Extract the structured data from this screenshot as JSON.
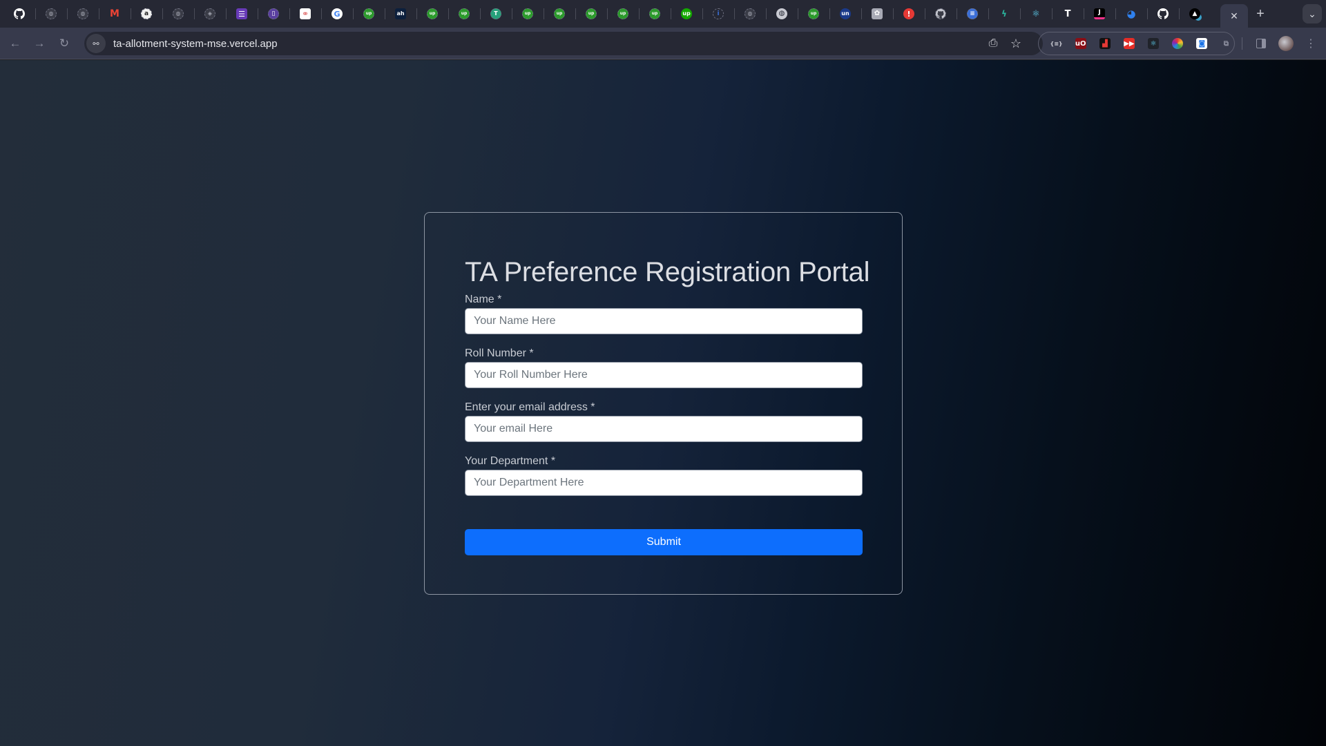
{
  "browser": {
    "tabs": [
      {
        "icon": "github-icon",
        "glyph": "",
        "style": "gh"
      },
      {
        "icon": "globe-icon",
        "glyph": "◍",
        "style": "globe"
      },
      {
        "icon": "globe-icon",
        "glyph": "◍",
        "style": "globe"
      },
      {
        "icon": "gmail-icon",
        "glyph": "M",
        "style": "gmail"
      },
      {
        "icon": "amazon-icon",
        "glyph": "a",
        "style": "amazon"
      },
      {
        "icon": "globe-icon",
        "glyph": "◍",
        "style": "globe"
      },
      {
        "icon": "shield-crest-icon",
        "glyph": "◈",
        "style": "globe"
      },
      {
        "icon": "list-icon",
        "glyph": "☰",
        "style": "list"
      },
      {
        "icon": "document-icon",
        "glyph": "▯",
        "style": "doc"
      },
      {
        "icon": "venn-icon",
        "glyph": "⚭",
        "style": "venn"
      },
      {
        "icon": "google-icon",
        "glyph": "G",
        "style": "google"
      },
      {
        "icon": "upwork-icon",
        "glyph": "up",
        "style": "upw"
      },
      {
        "icon": "ah-icon",
        "glyph": "ah",
        "style": "ah"
      },
      {
        "icon": "upwork-icon",
        "glyph": "up",
        "style": "upw"
      },
      {
        "icon": "upwork-icon",
        "glyph": "up",
        "style": "upw"
      },
      {
        "icon": "tether-icon",
        "glyph": "T",
        "style": "tether"
      },
      {
        "icon": "upwork-icon",
        "glyph": "up",
        "style": "upw"
      },
      {
        "icon": "upwork-icon",
        "glyph": "up",
        "style": "upw"
      },
      {
        "icon": "upwork-icon",
        "glyph": "up",
        "style": "upw"
      },
      {
        "icon": "upwork-icon",
        "glyph": "up",
        "style": "upw"
      },
      {
        "icon": "upwork-icon",
        "glyph": "up",
        "style": "upw"
      },
      {
        "icon": "upwork-logo-icon",
        "glyph": "up",
        "style": "upsolid"
      },
      {
        "icon": "info-icon",
        "glyph": "i",
        "style": "info"
      },
      {
        "icon": "globe-icon",
        "glyph": "◍",
        "style": "globe"
      },
      {
        "icon": "globe-solid-icon",
        "glyph": "◍",
        "style": "globesolid"
      },
      {
        "icon": "upwork-icon",
        "glyph": "up",
        "style": "upw"
      },
      {
        "icon": "unstop-icon",
        "glyph": "un",
        "style": "un"
      },
      {
        "icon": "openai-icon",
        "glyph": "✿",
        "style": "openai"
      },
      {
        "icon": "alert-icon",
        "glyph": "!",
        "style": "alert"
      },
      {
        "icon": "github-icon",
        "glyph": "",
        "style": "ghdash"
      },
      {
        "icon": "docs-icon",
        "glyph": "≡",
        "style": "docs"
      },
      {
        "icon": "squiggle-icon",
        "glyph": "ϟ",
        "style": "squig"
      },
      {
        "icon": "react-icon",
        "glyph": "⚛",
        "style": "react"
      },
      {
        "icon": "typora-icon",
        "glyph": "T",
        "style": "typora"
      },
      {
        "icon": "jetbrains-icon",
        "glyph": "J",
        "style": "jb"
      },
      {
        "icon": "octocat-icon",
        "glyph": "◕",
        "style": "octo"
      },
      {
        "icon": "github-icon",
        "glyph": "",
        "style": "gh"
      },
      {
        "icon": "vercel-icon",
        "glyph": "▲",
        "style": "vercel"
      }
    ],
    "active_tab": {
      "close_glyph": "✕"
    },
    "new_tab_glyph": "+",
    "tab_search_glyph": "⌄",
    "nav": {
      "back": "←",
      "forward": "→",
      "reload": "↻"
    },
    "url": "ta-allotment-system-mse.vercel.app",
    "site_info_glyph": "⚯",
    "install_glyph": "⎙",
    "bookmark_glyph": "☆",
    "extensions": [
      {
        "icon": "json-viewer-icon",
        "glyph": "{≡}",
        "bg": "transparent",
        "color": "#c9cad2"
      },
      {
        "icon": "ublock-origin-icon",
        "glyph": "uO",
        "bg": "#8a0f16",
        "color": "#ffffff"
      },
      {
        "icon": "analytics-icon",
        "glyph": "▟",
        "bg": "#111111",
        "color": "#e53935"
      },
      {
        "icon": "youtube-speed-icon",
        "glyph": "▶▶",
        "bg": "#e52d27",
        "color": "#ffffff"
      },
      {
        "icon": "react-devtools-icon",
        "glyph": "⚛",
        "bg": "#20232a",
        "color": "#61dafb"
      },
      {
        "icon": "color-picker-icon",
        "glyph": "●",
        "bg": "transparent",
        "color": "#e040fb"
      },
      {
        "icon": "screenshot-icon",
        "glyph": "◙",
        "bg": "#ffffff",
        "color": "#1a73e8"
      },
      {
        "icon": "puzzle-icon",
        "glyph": "⧉",
        "bg": "transparent",
        "color": "#8e90a0"
      }
    ],
    "menu_glyph": "⋮"
  },
  "form": {
    "title": "TA Preference Registration Portal",
    "fields": [
      {
        "label": "Name *",
        "placeholder": "Your Name Here",
        "value": ""
      },
      {
        "label": "Roll Number *",
        "placeholder": "Your Roll Number Here",
        "value": ""
      },
      {
        "label": "Enter your email address *",
        "placeholder": "Your email Here",
        "value": ""
      },
      {
        "label": "Your Department *",
        "placeholder": "Your Department Here",
        "value": ""
      }
    ],
    "submit_label": "Submit"
  },
  "colors": {
    "accent": "#0d6efd",
    "title_text": "#dcdee3",
    "label_text": "#c8ccd3",
    "card_border": "#8e96a3",
    "bg_left": "#232d3a",
    "bg_mid": "#15233a",
    "bg_right": "#020408"
  }
}
